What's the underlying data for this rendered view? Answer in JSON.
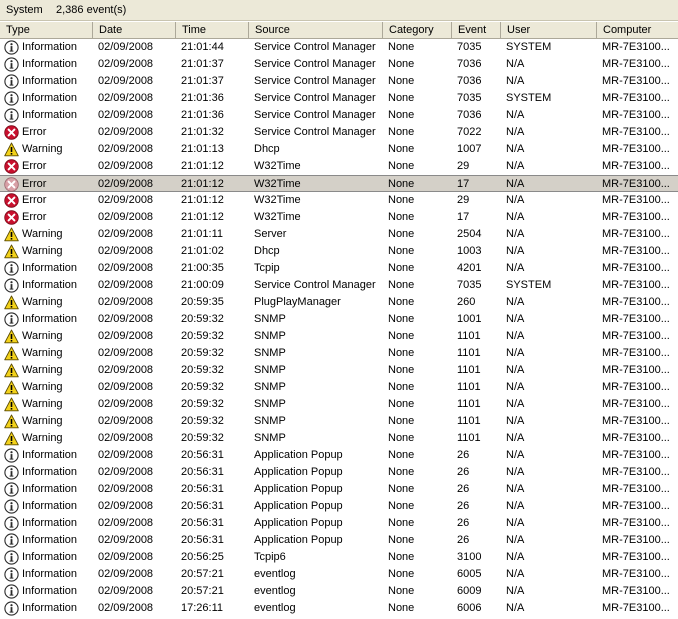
{
  "topbar": {
    "log_name": "System",
    "event_count": "2,386 event(s)"
  },
  "columns": {
    "type": "Type",
    "date": "Date",
    "time": "Time",
    "source": "Source",
    "category": "Category",
    "event": "Event",
    "user": "User",
    "computer": "Computer"
  },
  "colors": {
    "header_bg": "#ece9d8",
    "error": "#c8102e",
    "warning": "#f3d21a",
    "selected_row": "#d4d0c8"
  },
  "selected_index": 8,
  "rows": [
    {
      "type": "Information",
      "icon": "info-icon",
      "date": "02/09/2008",
      "time": "21:01:44",
      "source": "Service Control Manager",
      "category": "None",
      "event": "7035",
      "user": "SYSTEM",
      "computer": "MR-7E3100..."
    },
    {
      "type": "Information",
      "icon": "info-icon",
      "date": "02/09/2008",
      "time": "21:01:37",
      "source": "Service Control Manager",
      "category": "None",
      "event": "7036",
      "user": "N/A",
      "computer": "MR-7E3100..."
    },
    {
      "type": "Information",
      "icon": "info-icon",
      "date": "02/09/2008",
      "time": "21:01:37",
      "source": "Service Control Manager",
      "category": "None",
      "event": "7036",
      "user": "N/A",
      "computer": "MR-7E3100..."
    },
    {
      "type": "Information",
      "icon": "info-icon",
      "date": "02/09/2008",
      "time": "21:01:36",
      "source": "Service Control Manager",
      "category": "None",
      "event": "7035",
      "user": "SYSTEM",
      "computer": "MR-7E3100..."
    },
    {
      "type": "Information",
      "icon": "info-icon",
      "date": "02/09/2008",
      "time": "21:01:36",
      "source": "Service Control Manager",
      "category": "None",
      "event": "7036",
      "user": "N/A",
      "computer": "MR-7E3100..."
    },
    {
      "type": "Error",
      "icon": "error-icon",
      "date": "02/09/2008",
      "time": "21:01:32",
      "source": "Service Control Manager",
      "category": "None",
      "event": "7022",
      "user": "N/A",
      "computer": "MR-7E3100..."
    },
    {
      "type": "Warning",
      "icon": "warning-icon",
      "date": "02/09/2008",
      "time": "21:01:13",
      "source": "Dhcp",
      "category": "None",
      "event": "1007",
      "user": "N/A",
      "computer": "MR-7E3100..."
    },
    {
      "type": "Error",
      "icon": "error-icon",
      "date": "02/09/2008",
      "time": "21:01:12",
      "source": "W32Time",
      "category": "None",
      "event": "29",
      "user": "N/A",
      "computer": "MR-7E3100..."
    },
    {
      "type": "Error",
      "icon": "error-icon",
      "date": "02/09/2008",
      "time": "21:01:12",
      "source": "W32Time",
      "category": "None",
      "event": "17",
      "user": "N/A",
      "computer": "MR-7E3100..."
    },
    {
      "type": "Error",
      "icon": "error-icon",
      "date": "02/09/2008",
      "time": "21:01:12",
      "source": "W32Time",
      "category": "None",
      "event": "29",
      "user": "N/A",
      "computer": "MR-7E3100..."
    },
    {
      "type": "Error",
      "icon": "error-icon",
      "date": "02/09/2008",
      "time": "21:01:12",
      "source": "W32Time",
      "category": "None",
      "event": "17",
      "user": "N/A",
      "computer": "MR-7E3100..."
    },
    {
      "type": "Warning",
      "icon": "warning-icon",
      "date": "02/09/2008",
      "time": "21:01:11",
      "source": "Server",
      "category": "None",
      "event": "2504",
      "user": "N/A",
      "computer": "MR-7E3100..."
    },
    {
      "type": "Warning",
      "icon": "warning-icon",
      "date": "02/09/2008",
      "time": "21:01:02",
      "source": "Dhcp",
      "category": "None",
      "event": "1003",
      "user": "N/A",
      "computer": "MR-7E3100..."
    },
    {
      "type": "Information",
      "icon": "info-icon",
      "date": "02/09/2008",
      "time": "21:00:35",
      "source": "Tcpip",
      "category": "None",
      "event": "4201",
      "user": "N/A",
      "computer": "MR-7E3100..."
    },
    {
      "type": "Information",
      "icon": "info-icon",
      "date": "02/09/2008",
      "time": "21:00:09",
      "source": "Service Control Manager",
      "category": "None",
      "event": "7035",
      "user": "SYSTEM",
      "computer": "MR-7E3100..."
    },
    {
      "type": "Warning",
      "icon": "warning-icon",
      "date": "02/09/2008",
      "time": "20:59:35",
      "source": "PlugPlayManager",
      "category": "None",
      "event": "260",
      "user": "N/A",
      "computer": "MR-7E3100..."
    },
    {
      "type": "Information",
      "icon": "info-icon",
      "date": "02/09/2008",
      "time": "20:59:32",
      "source": "SNMP",
      "category": "None",
      "event": "1001",
      "user": "N/A",
      "computer": "MR-7E3100..."
    },
    {
      "type": "Warning",
      "icon": "warning-icon",
      "date": "02/09/2008",
      "time": "20:59:32",
      "source": "SNMP",
      "category": "None",
      "event": "1101",
      "user": "N/A",
      "computer": "MR-7E3100..."
    },
    {
      "type": "Warning",
      "icon": "warning-icon",
      "date": "02/09/2008",
      "time": "20:59:32",
      "source": "SNMP",
      "category": "None",
      "event": "1101",
      "user": "N/A",
      "computer": "MR-7E3100..."
    },
    {
      "type": "Warning",
      "icon": "warning-icon",
      "date": "02/09/2008",
      "time": "20:59:32",
      "source": "SNMP",
      "category": "None",
      "event": "1101",
      "user": "N/A",
      "computer": "MR-7E3100..."
    },
    {
      "type": "Warning",
      "icon": "warning-icon",
      "date": "02/09/2008",
      "time": "20:59:32",
      "source": "SNMP",
      "category": "None",
      "event": "1101",
      "user": "N/A",
      "computer": "MR-7E3100..."
    },
    {
      "type": "Warning",
      "icon": "warning-icon",
      "date": "02/09/2008",
      "time": "20:59:32",
      "source": "SNMP",
      "category": "None",
      "event": "1101",
      "user": "N/A",
      "computer": "MR-7E3100..."
    },
    {
      "type": "Warning",
      "icon": "warning-icon",
      "date": "02/09/2008",
      "time": "20:59:32",
      "source": "SNMP",
      "category": "None",
      "event": "1101",
      "user": "N/A",
      "computer": "MR-7E3100..."
    },
    {
      "type": "Warning",
      "icon": "warning-icon",
      "date": "02/09/2008",
      "time": "20:59:32",
      "source": "SNMP",
      "category": "None",
      "event": "1101",
      "user": "N/A",
      "computer": "MR-7E3100..."
    },
    {
      "type": "Information",
      "icon": "info-icon",
      "date": "02/09/2008",
      "time": "20:56:31",
      "source": "Application Popup",
      "category": "None",
      "event": "26",
      "user": "N/A",
      "computer": "MR-7E3100..."
    },
    {
      "type": "Information",
      "icon": "info-icon",
      "date": "02/09/2008",
      "time": "20:56:31",
      "source": "Application Popup",
      "category": "None",
      "event": "26",
      "user": "N/A",
      "computer": "MR-7E3100..."
    },
    {
      "type": "Information",
      "icon": "info-icon",
      "date": "02/09/2008",
      "time": "20:56:31",
      "source": "Application Popup",
      "category": "None",
      "event": "26",
      "user": "N/A",
      "computer": "MR-7E3100..."
    },
    {
      "type": "Information",
      "icon": "info-icon",
      "date": "02/09/2008",
      "time": "20:56:31",
      "source": "Application Popup",
      "category": "None",
      "event": "26",
      "user": "N/A",
      "computer": "MR-7E3100..."
    },
    {
      "type": "Information",
      "icon": "info-icon",
      "date": "02/09/2008",
      "time": "20:56:31",
      "source": "Application Popup",
      "category": "None",
      "event": "26",
      "user": "N/A",
      "computer": "MR-7E3100..."
    },
    {
      "type": "Information",
      "icon": "info-icon",
      "date": "02/09/2008",
      "time": "20:56:31",
      "source": "Application Popup",
      "category": "None",
      "event": "26",
      "user": "N/A",
      "computer": "MR-7E3100..."
    },
    {
      "type": "Information",
      "icon": "info-icon",
      "date": "02/09/2008",
      "time": "20:56:25",
      "source": "Tcpip6",
      "category": "None",
      "event": "3100",
      "user": "N/A",
      "computer": "MR-7E3100..."
    },
    {
      "type": "Information",
      "icon": "info-icon",
      "date": "02/09/2008",
      "time": "20:57:21",
      "source": "eventlog",
      "category": "None",
      "event": "6005",
      "user": "N/A",
      "computer": "MR-7E3100..."
    },
    {
      "type": "Information",
      "icon": "info-icon",
      "date": "02/09/2008",
      "time": "20:57:21",
      "source": "eventlog",
      "category": "None",
      "event": "6009",
      "user": "N/A",
      "computer": "MR-7E3100..."
    },
    {
      "type": "Information",
      "icon": "info-icon",
      "date": "02/09/2008",
      "time": "17:26:11",
      "source": "eventlog",
      "category": "None",
      "event": "6006",
      "user": "N/A",
      "computer": "MR-7E3100..."
    }
  ]
}
